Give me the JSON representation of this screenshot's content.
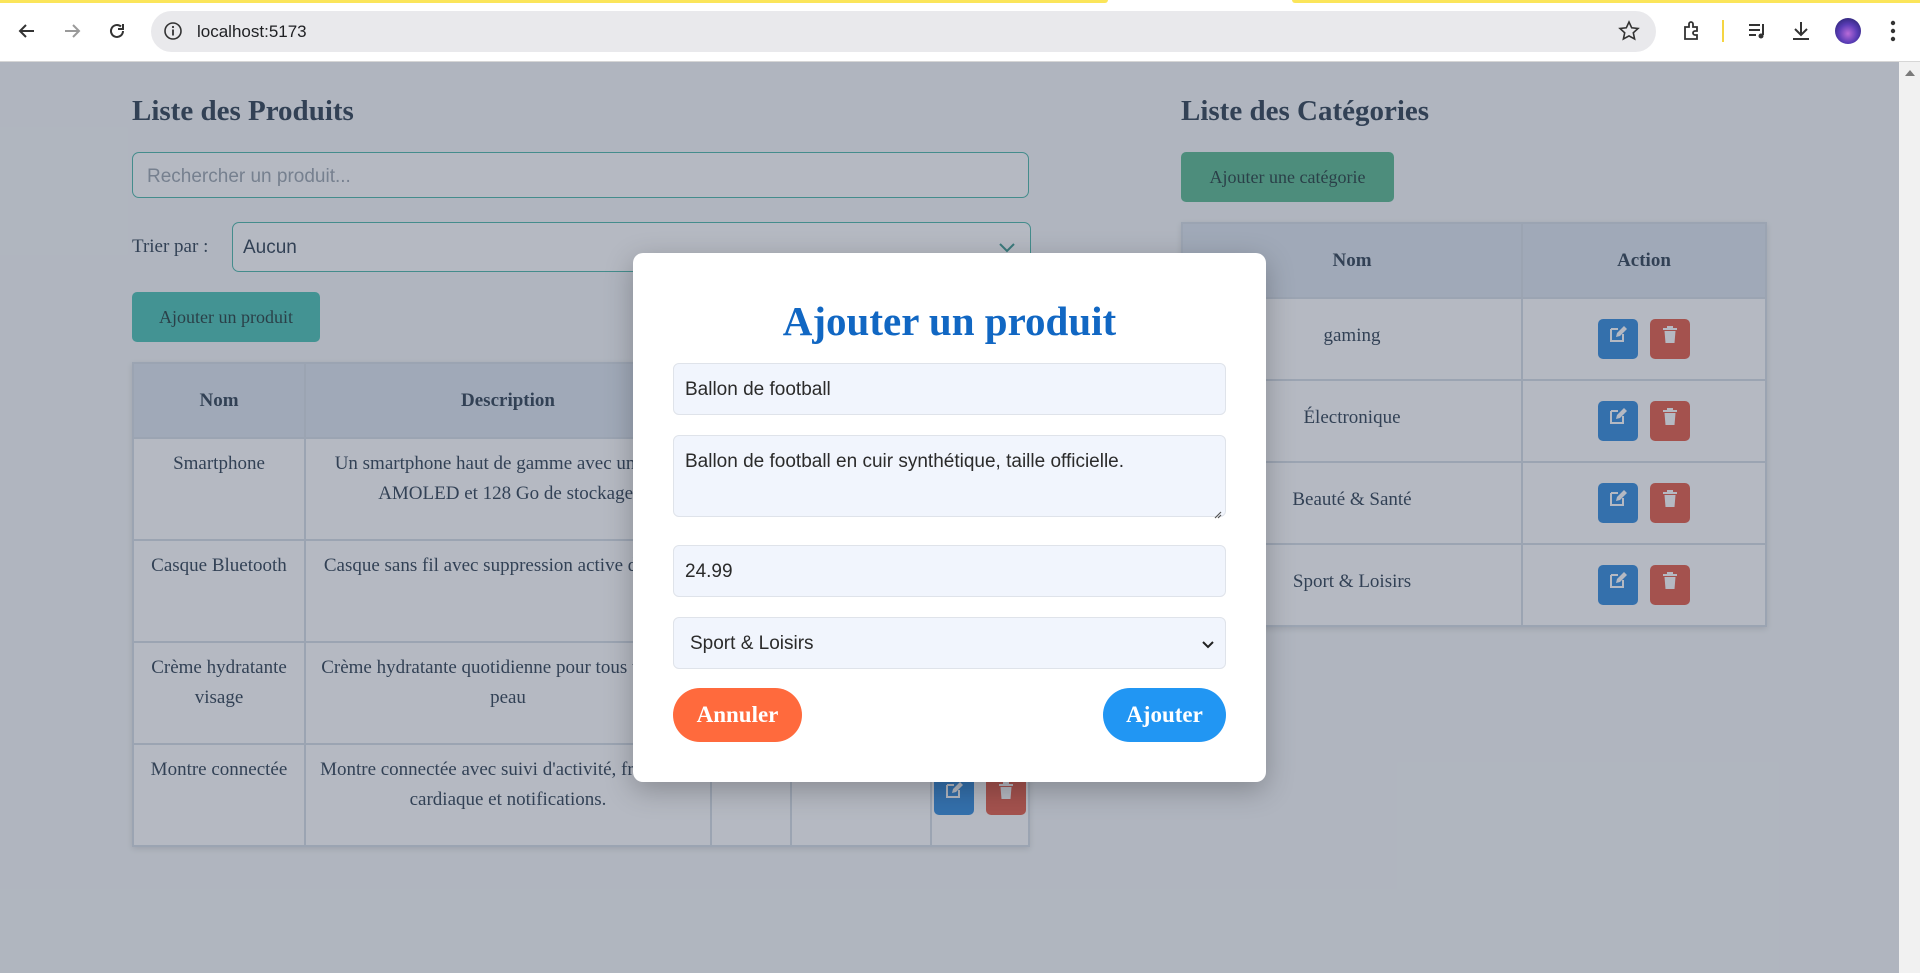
{
  "browser": {
    "url": "localhost:5173"
  },
  "products": {
    "title": "Liste des Produits",
    "search_placeholder": "Rechercher un produit...",
    "sort_label": "Trier par :",
    "sort_value": "Aucun",
    "add_button": "Ajouter un produit",
    "columns": [
      "Nom",
      "Description"
    ],
    "rows": [
      {
        "name": "Smartphone",
        "description": "Un smartphone haut de gamme avec un écran AMOLED et 128 Go de stockage."
      },
      {
        "name": "Casque Bluetooth",
        "description": "Casque sans fil avec suppression active du bruit."
      },
      {
        "name": "Crème hydratante visage",
        "description": "Crème hydratante quotidienne pour tous types de peau"
      },
      {
        "name": "Montre connectée",
        "description": "Montre connectée avec suivi d'activité, fréquence cardiaque et notifications."
      }
    ]
  },
  "categories": {
    "title": "Liste des Catégories",
    "add_button": "Ajouter une catégorie",
    "columns": [
      "Nom",
      "Action"
    ],
    "rows": [
      "gaming",
      "Électronique",
      "Beauté & Santé",
      "Sport & Loisirs"
    ]
  },
  "modal": {
    "title": "Ajouter un produit",
    "name_value": "Ballon de football",
    "description_value": "Ballon de football en cuir synthétique, taille officielle.",
    "price_value": "24.99",
    "category_value": "Sport & Loisirs",
    "cancel_label": "Annuler",
    "submit_label": "Ajouter"
  },
  "colors": {
    "accent_teal": "#48c2b3",
    "accent_green": "#58b88f",
    "modal_title": "#1167c3",
    "cancel": "#ff6a3d",
    "submit": "#2196f3",
    "edit": "#2f89dc",
    "delete": "#e45a45"
  },
  "icons": [
    "back-icon",
    "forward-icon",
    "reload-icon",
    "info-icon",
    "star-icon",
    "extensions-icon",
    "media-icon",
    "download-icon",
    "menu-icon",
    "edit-icon",
    "trash-icon",
    "chevron-down-icon"
  ]
}
